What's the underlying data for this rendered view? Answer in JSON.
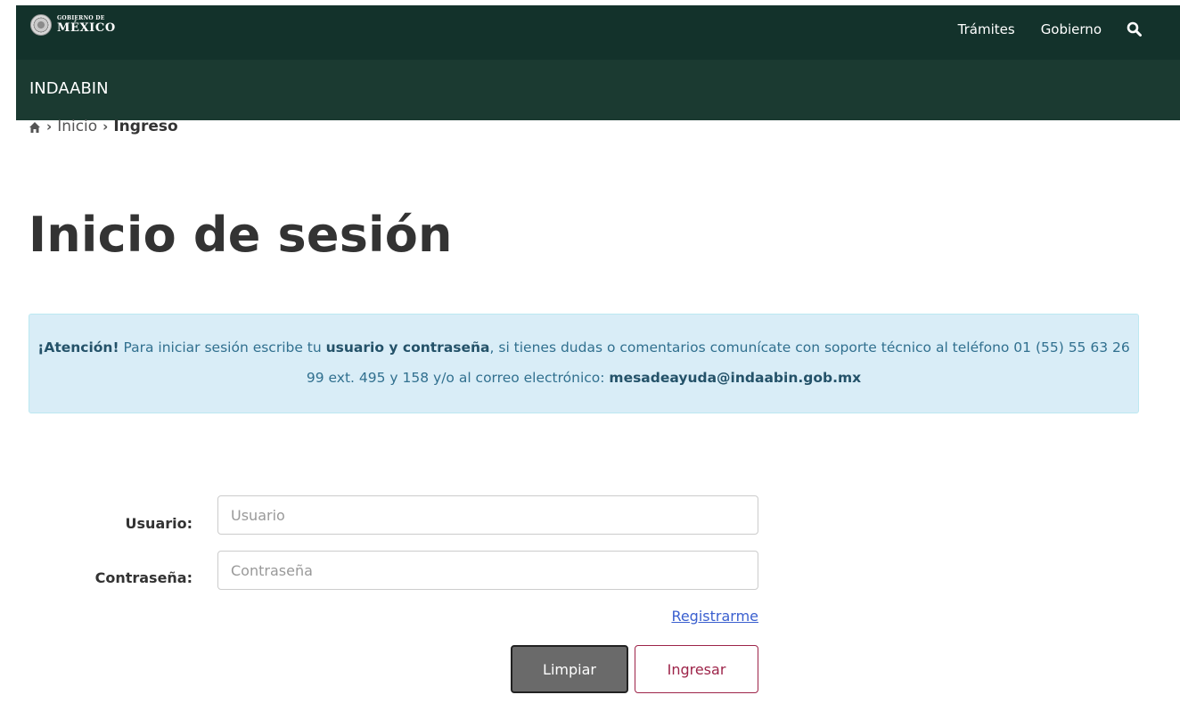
{
  "header": {
    "logo_small": "GOBIERNO DE",
    "logo_big": "MÉXICO",
    "nav": [
      "Trámites",
      "Gobierno"
    ],
    "search_icon": "search-icon"
  },
  "subheader": {
    "title": "INDAABIN"
  },
  "breadcrumb": {
    "home_icon": "home-icon",
    "items": [
      "Inicio",
      "Ingreso"
    ]
  },
  "page": {
    "title": "Inicio de sesión"
  },
  "alert": {
    "lead": "¡Atención!",
    "text1": " Para iniciar sesión escribe tu ",
    "bold1": "usuario y contraseña",
    "text2": ", si tienes dudas o comentarios comunícate con soporte técnico al teléfono 01 (55) 55 63 26 99 ext. 495 y 158 y/o al correo electrónico: ",
    "email": "mesadeayuda@indaabin.gob.mx"
  },
  "form": {
    "user_label": "Usuario:",
    "user_placeholder": "Usuario",
    "user_value": "",
    "password_label": "Contraseña:",
    "password_placeholder": "Contraseña",
    "password_value": "",
    "register_link": "Registrarme",
    "clear_button": "Limpiar",
    "submit_button": "Ingresar"
  },
  "colors": {
    "topbar": "#13322b",
    "subbar": "#1b3a31",
    "alert_bg": "#d9edf7",
    "accent": "#9d2449",
    "link": "#3a5fcf"
  }
}
